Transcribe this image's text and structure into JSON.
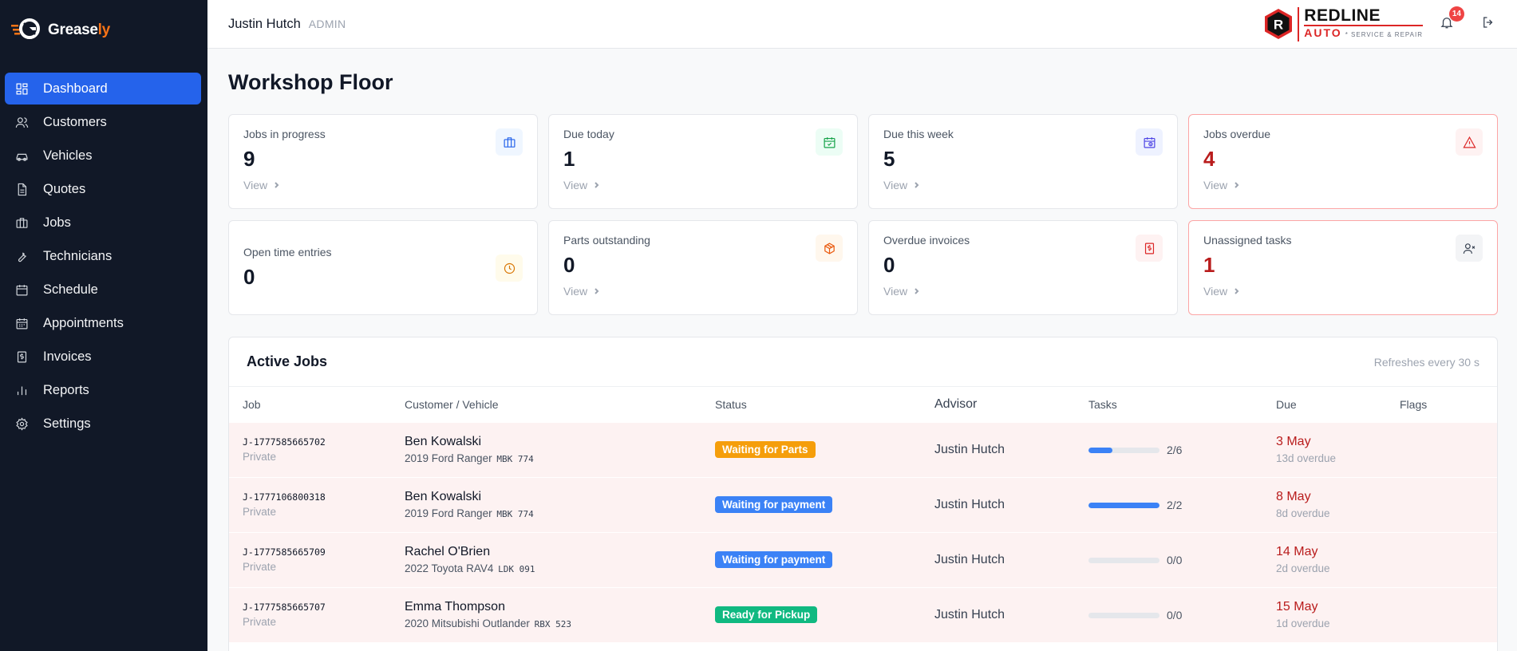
{
  "brand": {
    "name_main": "Grease",
    "name_accent": "ly"
  },
  "sidebar": {
    "items": [
      {
        "label": "Dashboard",
        "icon": "dashboard-icon",
        "active": true
      },
      {
        "label": "Customers",
        "icon": "users-icon"
      },
      {
        "label": "Vehicles",
        "icon": "car-icon"
      },
      {
        "label": "Quotes",
        "icon": "document-icon"
      },
      {
        "label": "Jobs",
        "icon": "briefcase-icon"
      },
      {
        "label": "Technicians",
        "icon": "wrench-icon"
      },
      {
        "label": "Schedule",
        "icon": "calendar-icon"
      },
      {
        "label": "Appointments",
        "icon": "calendar-days-icon"
      },
      {
        "label": "Invoices",
        "icon": "receipt-icon"
      },
      {
        "label": "Reports",
        "icon": "bar-chart-icon"
      },
      {
        "label": "Settings",
        "icon": "gear-icon"
      }
    ]
  },
  "header": {
    "user_name": "Justin Hutch",
    "user_role": "ADMIN",
    "logo_top": "REDLINE",
    "logo_bottom": "AUTO",
    "logo_sub": "* SERVICE & REPAIR",
    "logo_letter": "R",
    "notifications": "14"
  },
  "page": {
    "title": "Workshop Floor"
  },
  "stats": [
    {
      "label": "Jobs in progress",
      "value": "9",
      "link": "View",
      "icon": "briefcase-icon",
      "tone": "blue"
    },
    {
      "label": "Due today",
      "value": "1",
      "link": "View",
      "icon": "calendar-check-icon",
      "tone": "green"
    },
    {
      "label": "Due this week",
      "value": "5",
      "link": "View",
      "icon": "calendar-clock-icon",
      "tone": "indigo"
    },
    {
      "label": "Jobs overdue",
      "value": "4",
      "link": "View",
      "icon": "warning-icon",
      "tone": "red",
      "alert": true
    },
    {
      "label": "Open time entries",
      "value": "0",
      "link": "",
      "icon": "clock-icon",
      "tone": "amber"
    },
    {
      "label": "Parts outstanding",
      "value": "0",
      "link": "View",
      "icon": "box-icon",
      "tone": "orange"
    },
    {
      "label": "Overdue invoices",
      "value": "0",
      "link": "View",
      "icon": "invoice-dollar-icon",
      "tone": "red"
    },
    {
      "label": "Unassigned tasks",
      "value": "1",
      "link": "View",
      "icon": "user-x-icon",
      "tone": "gray",
      "alert": true
    }
  ],
  "active_jobs": {
    "title": "Active Jobs",
    "note": "Refreshes every 30 s",
    "columns": [
      "Job",
      "Customer / Vehicle",
      "Status",
      "Advisor",
      "Tasks",
      "Due",
      "Flags"
    ],
    "rows": [
      {
        "job_id": "J-1777585665702",
        "type": "Private",
        "customer": "Ben Kowalski",
        "vehicle": "2019 Ford Ranger",
        "plate": "MBK 774",
        "status": "Waiting for Parts",
        "status_color": "#f59e0b",
        "advisor": "Justin Hutch",
        "tasks": "2/6",
        "progress": 0.333,
        "due": "3 May",
        "due_note": "13d overdue"
      },
      {
        "job_id": "J-1777106800318",
        "type": "Private",
        "customer": "Ben Kowalski",
        "vehicle": "2019 Ford Ranger",
        "plate": "MBK 774",
        "status": "Waiting for payment",
        "status_color": "#3b82f6",
        "advisor": "Justin Hutch",
        "tasks": "2/2",
        "progress": 1,
        "due": "8 May",
        "due_note": "8d overdue"
      },
      {
        "job_id": "J-1777585665709",
        "type": "Private",
        "customer": "Rachel O'Brien",
        "vehicle": "2022 Toyota RAV4",
        "plate": "LDK 091",
        "status": "Waiting for payment",
        "status_color": "#3b82f6",
        "advisor": "Justin Hutch",
        "tasks": "0/0",
        "progress": 0,
        "due": "14 May",
        "due_note": "2d overdue"
      },
      {
        "job_id": "J-1777585665707",
        "type": "Private",
        "customer": "Emma Thompson",
        "vehicle": "2020 Mitsubishi Outlander",
        "plate": "RBX 523",
        "status": "Ready for Pickup",
        "status_color": "#10b981",
        "advisor": "Justin Hutch",
        "tasks": "0/0",
        "progress": 0,
        "due": "15 May",
        "due_note": "1d overdue"
      }
    ]
  }
}
